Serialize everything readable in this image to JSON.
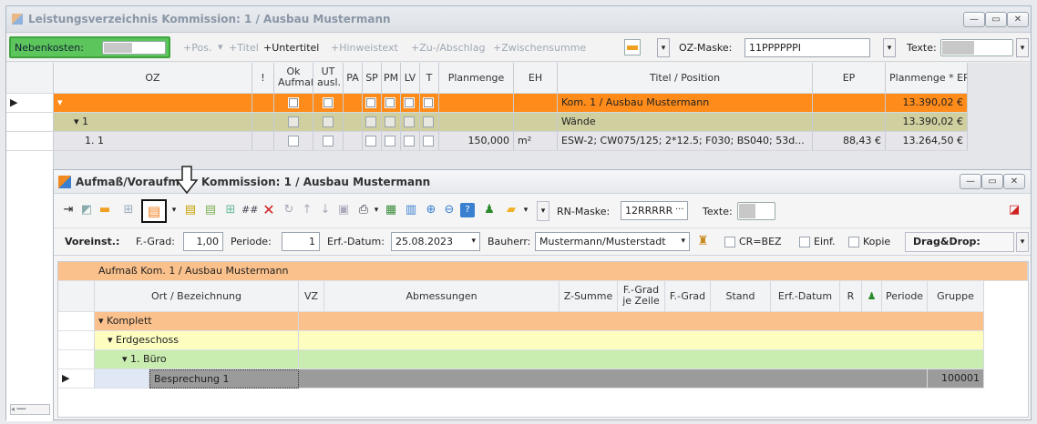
{
  "main_window": {
    "title": "Leistungsverzeichnis Kommission: 1 / Ausbau Mustermann",
    "nebenkosten_label": "Nebenkosten:",
    "toolbar": {
      "pos": "+Pos.",
      "titel": "+Titel",
      "untertitel": "+Untertitel",
      "hinweistext": "+Hinweistext",
      "zuabschlag": "+Zu-/Abschlag",
      "zwischensumme": "+Zwischensumme"
    },
    "oz_maske_label": "OZ-Maske:",
    "oz_maske_value": "11PPPPPPI",
    "texte_label": "Texte:",
    "columns": [
      "OZ",
      "!",
      "Ok Aufmaß",
      "UT ausl.",
      "PA",
      "SP",
      "PM",
      "LV",
      "T",
      "Planmenge",
      "EH",
      "Titel / Position",
      "EP",
      "Planmenge * EP"
    ],
    "rows": [
      {
        "oz": "",
        "planmenge": "",
        "eh": "",
        "titel": "Kom. 1 / Ausbau Mustermann",
        "ep": "",
        "total": "13.390,02 €"
      },
      {
        "oz": "1",
        "planmenge": "",
        "eh": "",
        "titel": "Wände",
        "ep": "",
        "total": "13.390,02 €"
      },
      {
        "oz": "1.  1",
        "planmenge": "150,000",
        "eh": "m²",
        "titel": "ESW-2; CW075/125; 2*12.5; F030; BS040; 53d...",
        "ep": "88,43 €",
        "total": "13.264,50 €"
      }
    ]
  },
  "sub_window": {
    "title": "Aufmaß/Voraufmaß Kommission: 1 / Ausbau Mustermann",
    "title_visible": "Aufmaß/Voraufm",
    "title_rest": "Kommission: 1 / Ausbau Mustermann",
    "rn_maske_label": "RN-Maske:",
    "rn_maske_value": "12RRRRR",
    "texte_label": "Texte:",
    "voreinst_label": "Voreinst.:",
    "fgrad_label": "F.-Grad:",
    "fgrad_value": "1,00",
    "periode_label": "Periode:",
    "periode_value": "1",
    "erfdatum_label": "Erf.-Datum:",
    "erfdatum_value": "25.08.2023",
    "bauherr_label": "Bauherr:",
    "bauherr_value": "Mustermann/Musterstadt",
    "cr_label": "CR=BEZ",
    "einf_label": "Einf.",
    "kopie_label": "Kopie",
    "dragdrop_label": "Drag&Drop:",
    "group_header": "Aufmaß Kom. 1 / Ausbau Mustermann",
    "columns": [
      "Ort / Bezeichnung",
      "VZ",
      "Abmessungen",
      "Z-Summe",
      "F.-Grad je Zeile",
      "F.-Grad",
      "Stand",
      "Erf.-Datum",
      "R",
      "",
      "Periode",
      "Gruppe"
    ],
    "rows": [
      {
        "label": "Komplett",
        "gruppe": ""
      },
      {
        "label": "Erdgeschoss",
        "gruppe": ""
      },
      {
        "label": "1. Büro",
        "gruppe": ""
      },
      {
        "label": "Besprechung 1",
        "gruppe": "100001"
      }
    ]
  },
  "colors": {
    "orange": "#fbc18c",
    "olive": "#cfcfa0",
    "yellow": "#fdfdc0",
    "green": "#c9ecb0",
    "gray": "#9b9b9b",
    "highlight": "#ff8c1a"
  }
}
